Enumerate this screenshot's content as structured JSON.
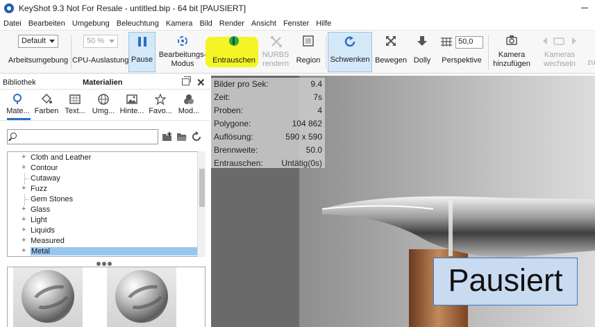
{
  "window": {
    "title": "KeyShot 9.3 Not For Resale  -  untitled.bip  -  64 bit [PAUSIERT]"
  },
  "menu": [
    "Datei",
    "Bearbeiten",
    "Umgebung",
    "Beleuchtung",
    "Kamera",
    "Bild",
    "Render",
    "Ansicht",
    "Fenster",
    "Hilfe"
  ],
  "toolbar": {
    "workspace_select": "Default",
    "workspace_label": "Arbeitsumgebung",
    "cpu_select": "50 %",
    "cpu_label": "CPU-Auslastung",
    "pause_label": "Pause",
    "edit_mode_label_1": "Bearbeitungs-",
    "edit_mode_label_2": "Modus",
    "denoise_label": "Entrauschen",
    "nurbs_label_1": "NURBS",
    "nurbs_label_2": "rendern",
    "region_label": "Region",
    "tumble_label": "Schwenken",
    "move_label": "Bewegen",
    "dolly_label": "Dolly",
    "perspective_value": "50,0",
    "perspective_label": "Perspektive",
    "add_camera_label_1": "Kamera",
    "add_camera_label_2": "hinzufügen",
    "switch_camera_label_1": "Kameras",
    "switch_camera_label_2": "wechseln",
    "overflow_label": "zu"
  },
  "library_panel": {
    "header_label": "Bibliothek",
    "section_title": "Materialien",
    "tabs": [
      {
        "label": "Mate..."
      },
      {
        "label": "Farben"
      },
      {
        "label": "Text..."
      },
      {
        "label": "Umg..."
      },
      {
        "label": "Hinte..."
      },
      {
        "label": "Favo..."
      },
      {
        "label": "Mod..."
      }
    ],
    "search": {
      "value": "",
      "placeholder": ""
    },
    "tree": [
      {
        "label": "Cloth and Leather",
        "expandable": true,
        "selected": false
      },
      {
        "label": "Contour",
        "expandable": true,
        "selected": false
      },
      {
        "label": "Cutaway",
        "expandable": false,
        "selected": false
      },
      {
        "label": "Fuzz",
        "expandable": true,
        "selected": false
      },
      {
        "label": "Gem Stones",
        "expandable": false,
        "selected": false
      },
      {
        "label": "Glass",
        "expandable": true,
        "selected": false
      },
      {
        "label": "Light",
        "expandable": true,
        "selected": false
      },
      {
        "label": "Liquids",
        "expandable": true,
        "selected": false
      },
      {
        "label": "Measured",
        "expandable": true,
        "selected": false
      },
      {
        "label": "Metal",
        "expandable": true,
        "selected": true
      }
    ]
  },
  "viewport": {
    "stats": [
      {
        "key": "Bilder pro Sek:",
        "value": "9.4"
      },
      {
        "key": "Zeit:",
        "value": "7s"
      },
      {
        "key": "Proben:",
        "value": "4"
      },
      {
        "key": "Polygone:",
        "value": "104 862"
      },
      {
        "key": "Auflösung:",
        "value": "590 x 590"
      },
      {
        "key": "Brennweite:",
        "value": "50.0"
      },
      {
        "key": "Entrauschen:",
        "value": "Untätig(0s)"
      }
    ],
    "paused_label": "Pausiert"
  },
  "colors": {
    "accent": "#2c6ec6",
    "active_button": "#d5e8f8",
    "highlight_marker": "#f4f300",
    "selection": "#99c6ee"
  }
}
